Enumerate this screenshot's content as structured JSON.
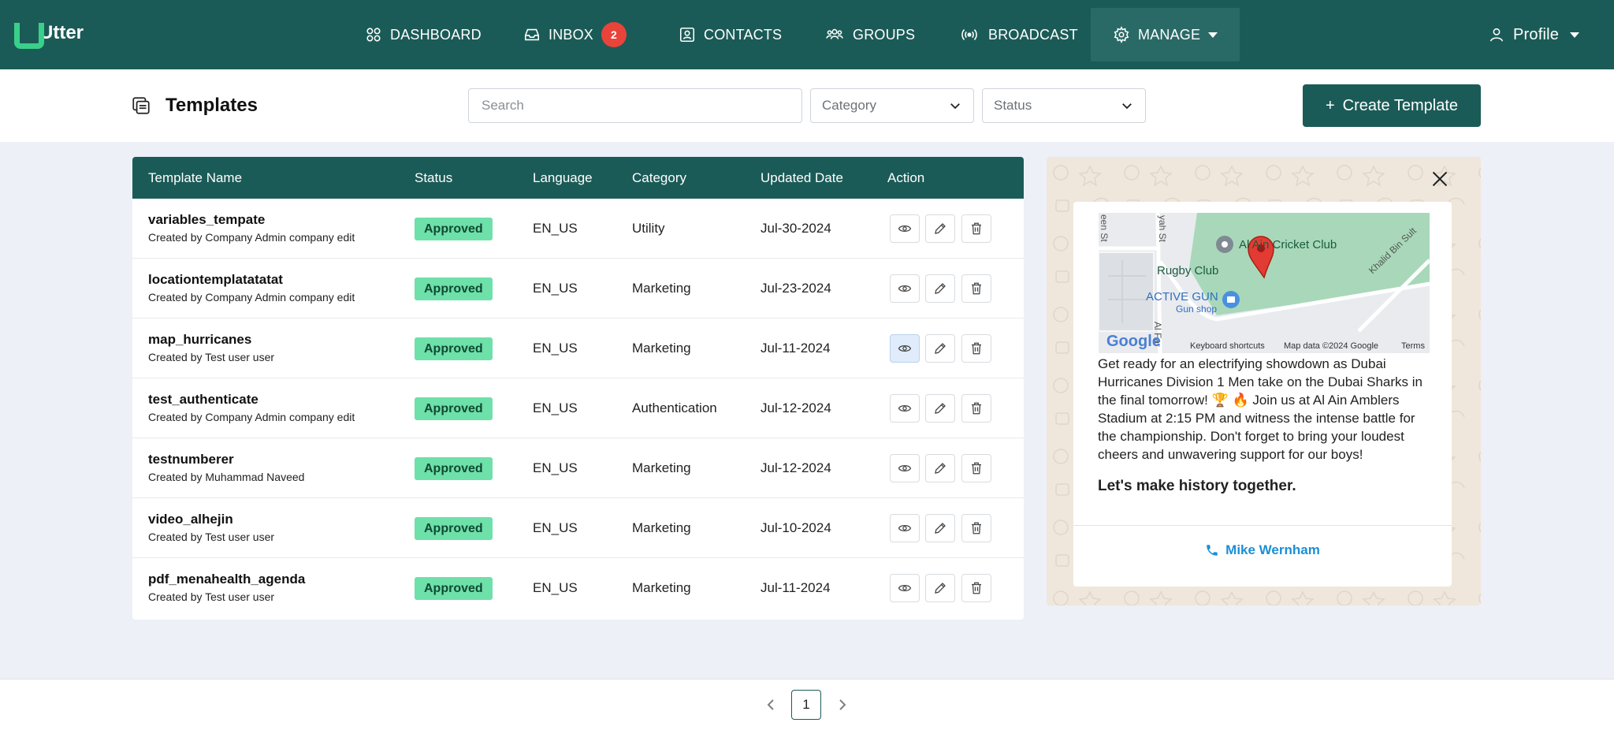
{
  "app": {
    "name": "Utter"
  },
  "nav": {
    "dashboard": "DASHBOARD",
    "inbox": "INBOX",
    "inbox_badge": "2",
    "contacts": "CONTACTS",
    "groups": "GROUPS",
    "broadcast": "BROADCAST",
    "manage": "MANAGE",
    "profile": "Profile"
  },
  "page": {
    "title": "Templates"
  },
  "filters": {
    "search_placeholder": "Search",
    "category": "Category",
    "status": "Status"
  },
  "create_button": "Create Template",
  "table": {
    "headers": {
      "name": "Template Name",
      "status": "Status",
      "language": "Language",
      "category": "Category",
      "updated": "Updated Date",
      "action": "Action"
    },
    "rows": [
      {
        "name": "variables_tempate",
        "creator": "Created by Company Admin company edit",
        "status": "Approved",
        "language": "EN_US",
        "category": "Utility",
        "updated": "Jul-30-2024"
      },
      {
        "name": "locationtemplatatatat",
        "creator": "Created by Company Admin company edit",
        "status": "Approved",
        "language": "EN_US",
        "category": "Marketing",
        "updated": "Jul-23-2024"
      },
      {
        "name": "map_hurricanes",
        "creator": "Created by Test user user",
        "status": "Approved",
        "language": "EN_US",
        "category": "Marketing",
        "updated": "Jul-11-2024"
      },
      {
        "name": "test_authenticate",
        "creator": "Created by Company Admin company edit",
        "status": "Approved",
        "language": "EN_US",
        "category": "Authentication",
        "updated": "Jul-12-2024"
      },
      {
        "name": "testnumberer",
        "creator": "Created by Muhammad Naveed",
        "status": "Approved",
        "language": "EN_US",
        "category": "Marketing",
        "updated": "Jul-12-2024"
      },
      {
        "name": "video_alhejin",
        "creator": "Created by Test user user",
        "status": "Approved",
        "language": "EN_US",
        "category": "Marketing",
        "updated": "Jul-10-2024"
      },
      {
        "name": "pdf_menahealth_agenda",
        "creator": "Created by Test user user",
        "status": "Approved",
        "language": "EN_US",
        "category": "Marketing",
        "updated": "Jul-11-2024"
      }
    ]
  },
  "preview": {
    "map": {
      "labels": {
        "cricket_club": "Al Ain Cricket Club",
        "rugby_club": "Rugby Club",
        "active_gun": "ACTIVE GUN",
        "gun_shop": "Gun shop",
        "road_khalid": "Khalid Bin Sult",
        "road_yah": "yah St",
        "road_een": "een St",
        "road_al_far": "Al Far",
        "google": "Google",
        "shortcuts": "Keyboard shortcuts",
        "map_data": "Map data ©2024 Google",
        "terms": "Terms"
      }
    },
    "message": "Get ready for an electrifying showdown as Dubai Hurricanes Division 1 Men take on the Dubai Sharks in the final tomorrow! 🏆 🔥 Join us at Al Ain Amblers Stadium at 2:15 PM and witness the intense battle for the championship. Don't forget to bring your loudest cheers and unwavering support for our boys!",
    "message_bold": "Let's make history together.",
    "call_button": "Mike Wernham"
  },
  "pagination": {
    "current": "1"
  },
  "colors": {
    "primary": "#1b5b57",
    "approved": "#6ee0a9",
    "badge": "#e8443a",
    "link": "#1a8fd6"
  }
}
